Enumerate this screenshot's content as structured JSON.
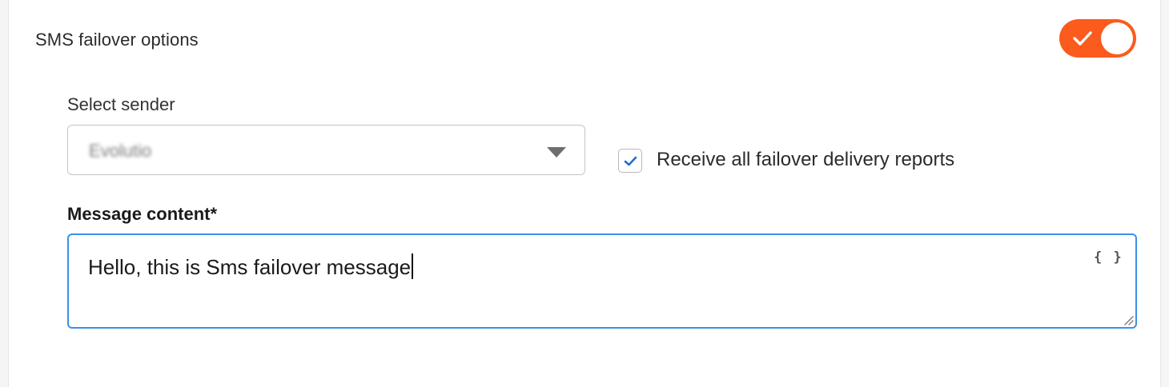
{
  "section": {
    "title": "SMS failover options",
    "toggle_on": true
  },
  "sender": {
    "label": "Select sender",
    "value": "Evolutio"
  },
  "reports": {
    "label": "Receive all failover delivery reports",
    "checked": true
  },
  "message": {
    "label": "Message content*",
    "value": "Hello, this is Sms failover message",
    "variable_icon": "{ }"
  },
  "colors": {
    "accent": "#fb5b1c",
    "focus_border": "#3b91e8",
    "check": "#1f6fd1"
  },
  "icons": {
    "toggle": "check-icon",
    "select": "chevron-down-icon",
    "checkbox": "check-icon",
    "variables": "braces-icon",
    "resize": "resize-handle-icon"
  }
}
